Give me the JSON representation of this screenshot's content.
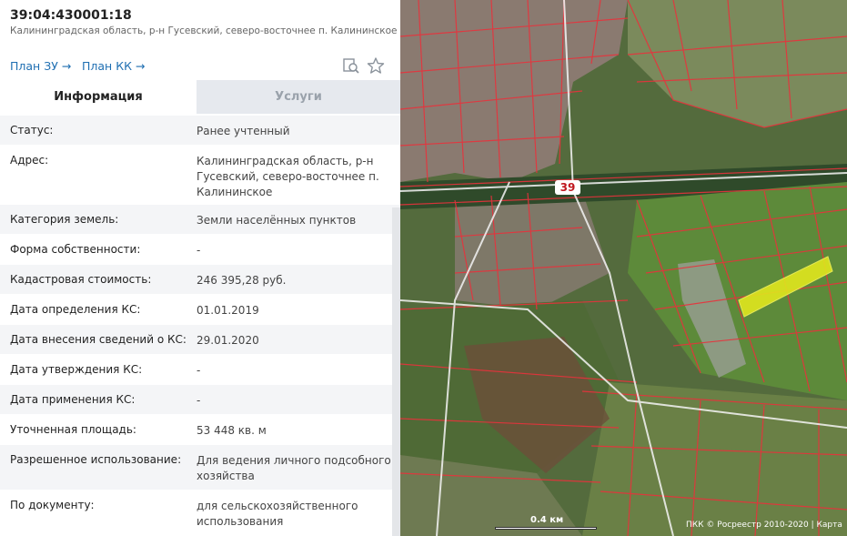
{
  "header": {
    "cadastral_number": "39:04:430001:18",
    "address_line": "Калининградская область, р-н Гусевский, северо-восточнее п. Калининское",
    "plan_zu": "План ЗУ →",
    "plan_kk": "План КК →",
    "search_icon": "search-document-icon",
    "favorite_icon": "star-icon"
  },
  "tabs": {
    "info": "Информация",
    "services": "Услуги"
  },
  "rows": [
    {
      "label": "Статус:",
      "value": "Ранее учтенный"
    },
    {
      "label": "Адрес:",
      "value": "Калининградская область, р-н Гусевский, северо-восточнее п. Калининское"
    },
    {
      "label": "Категория земель:",
      "value": "Земли населённых пунктов"
    },
    {
      "label": "Форма собственности:",
      "value": "-"
    },
    {
      "label": "Кадастровая стоимость:",
      "value": "246 395,28 руб."
    },
    {
      "label": "Дата определения КС:",
      "value": "01.01.2019"
    },
    {
      "label": "Дата внесения сведений о КС:",
      "value": "29.01.2020"
    },
    {
      "label": "Дата утверждения КС:",
      "value": "-"
    },
    {
      "label": "Дата применения КС:",
      "value": "-"
    },
    {
      "label": "Уточненная площадь:",
      "value": "53 448 кв. м"
    },
    {
      "label": "Разрешенное использование:",
      "value": "Для ведения личного подсобного хозяйства"
    },
    {
      "label": "По документу:",
      "value": "для сельскохозяйственного использования"
    }
  ],
  "map": {
    "road_number": "39",
    "scale_label": "0.4 км",
    "copyright": "ПКК © Росреестр 2010-2020 | Карта",
    "colors": {
      "parcel_border": "#e8323c",
      "highlight_parcel": "#e0e61e",
      "field": "#5d8a3a"
    }
  }
}
